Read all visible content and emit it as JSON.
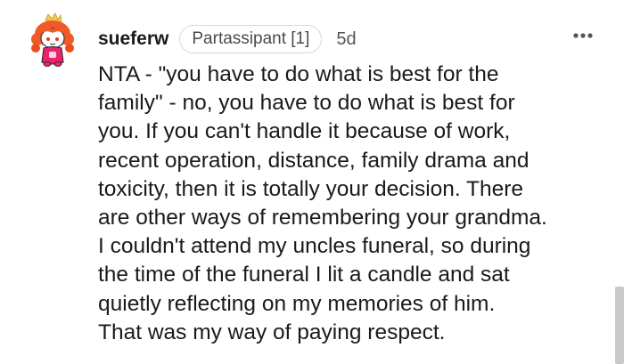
{
  "comment": {
    "avatar_icon": "snoo-avatar-icon",
    "username": "sueferw",
    "flair": "Partassipant [1]",
    "timestamp": "5d",
    "more_icon": "more-options-icon",
    "body_lines": [
      "NTA - \"you have to do what is best for the",
      "family\" - no, you have to do what is best for",
      "you. If you can't handle it because of work,",
      "recent operation, distance, family drama and",
      "toxicity, then it is totally your decision. There",
      "are other ways of remembering your grandma.",
      "I couldn't attend my uncles funeral, so during",
      "the time of the funeral I lit a candle and sat",
      "quietly reflecting on my memories of him.",
      "That was my way of paying respect."
    ]
  },
  "colors": {
    "text": "#1a1a1b",
    "flair_border": "#d9d9d9",
    "muted": "#555555",
    "scrollbar": "#c9c9c9",
    "avatar_hair": "#f05a28",
    "avatar_outfit": "#e8246b"
  }
}
